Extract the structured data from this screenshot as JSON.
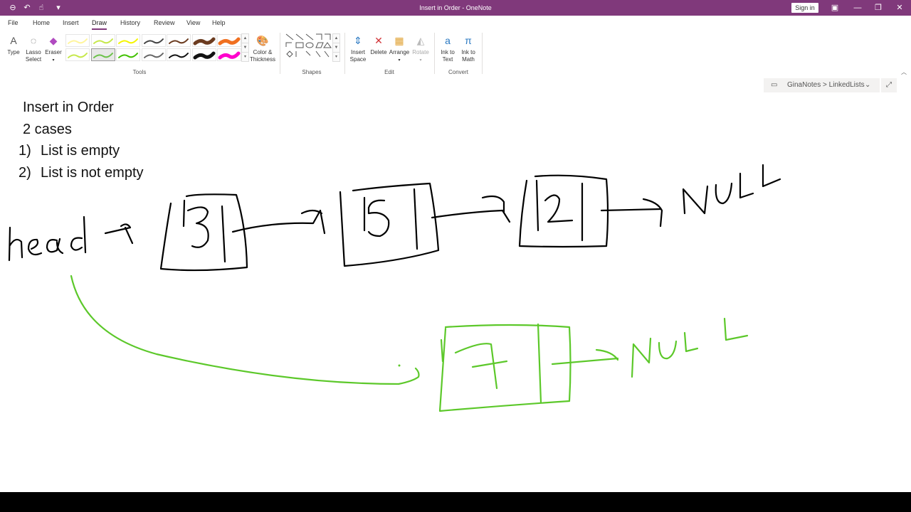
{
  "window": {
    "title": "Insert in Order - OneNote",
    "sign_in": "Sign in",
    "accent_color": "#80397B"
  },
  "tabs": [
    "File",
    "Home",
    "Insert",
    "Draw",
    "History",
    "Review",
    "View",
    "Help"
  ],
  "active_tab": "Draw",
  "ribbon": {
    "tools_group": "Tools",
    "shapes_group": "Shapes",
    "edit_group": "Edit",
    "convert_group": "Convert",
    "type_label": "Type",
    "lasso_label_1": "Lasso",
    "lasso_label_2": "Select",
    "eraser_label": "Eraser",
    "color_label_1": "Color &",
    "color_label_2": "Thickness",
    "insert_space_1": "Insert",
    "insert_space_2": "Space",
    "delete_label": "Delete",
    "arrange_label": "Arrange",
    "rotate_label": "Rotate",
    "ink_text_1": "Ink to",
    "ink_text_2": "Text",
    "ink_math_1": "Ink to",
    "ink_math_2": "Math"
  },
  "breadcrumb": "GinaNotes > LinkedLists",
  "note": {
    "line1": "Insert in Order",
    "line2": "2 cases",
    "line3_num": "1)",
    "line3_text": "List is empty",
    "line4_num": "2)",
    "line4_text": "List is not empty"
  },
  "pens": [
    {
      "color": "#fff59d",
      "selected": false
    },
    {
      "color": "#c6e84b",
      "selected": false
    },
    {
      "color": "#f5f500",
      "selected": false
    },
    {
      "color": "#444444",
      "selected": false
    },
    {
      "color": "#6b3b1f",
      "selected": false
    },
    {
      "color": "#6b3b1f",
      "selected": false
    },
    {
      "color": "#f07020",
      "selected": false
    },
    {
      "color": "#c6e84b",
      "selected": false
    },
    {
      "color": "#6cc24a",
      "selected": true
    },
    {
      "color": "#40c000",
      "selected": false
    },
    {
      "color": "#666666",
      "selected": false
    },
    {
      "color": "#111111",
      "selected": false
    },
    {
      "color": "#111111",
      "selected": false
    },
    {
      "color": "#ff00cc",
      "selected": false
    }
  ]
}
